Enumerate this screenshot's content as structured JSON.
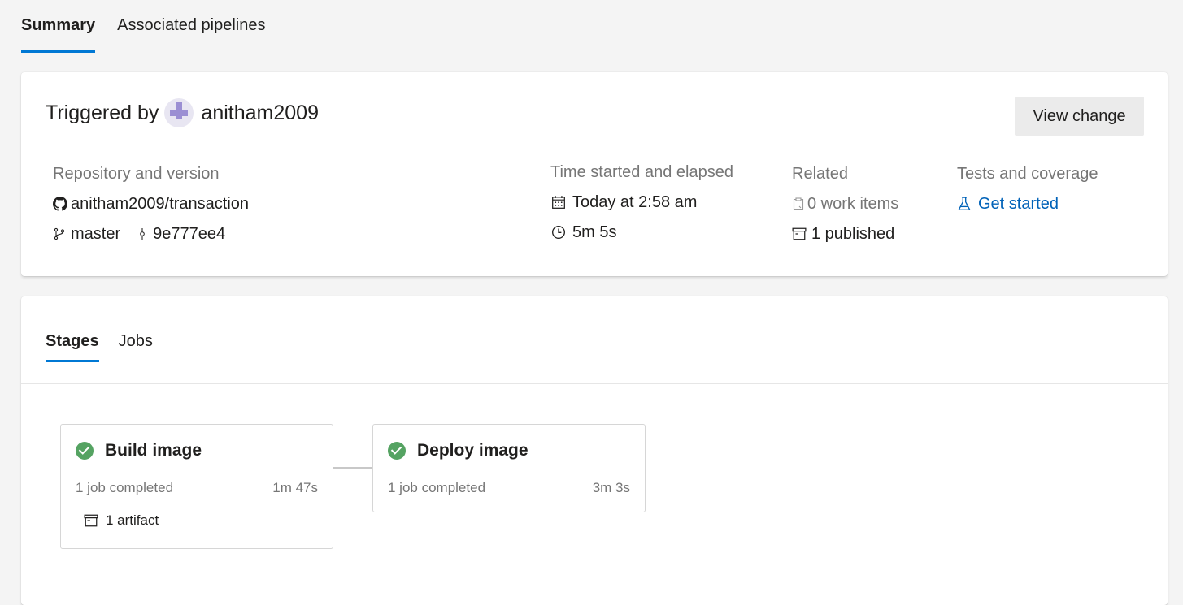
{
  "tabs": [
    {
      "label": "Summary",
      "active": true
    },
    {
      "label": "Associated pipelines",
      "active": false
    }
  ],
  "summary": {
    "triggered_prefix": "Triggered by",
    "user": "anitham2009",
    "view_change_label": "View change",
    "repository": {
      "label": "Repository and version",
      "repo": "anitham2009/transaction",
      "branch": "master",
      "commit": "9e777ee4"
    },
    "time": {
      "label": "Time started and elapsed",
      "started": "Today at 2:58 am",
      "elapsed": "5m 5s"
    },
    "related": {
      "label": "Related",
      "work_items": "0 work items",
      "published": "1 published"
    },
    "tests": {
      "label": "Tests and coverage",
      "link": "Get started"
    }
  },
  "stage_tabs": [
    {
      "label": "Stages",
      "active": true
    },
    {
      "label": "Jobs",
      "active": false
    }
  ],
  "stages": [
    {
      "name": "Build image",
      "jobs": "1 job completed",
      "duration": "1m 47s",
      "artifact": "1 artifact",
      "status": "succeeded"
    },
    {
      "name": "Deploy image",
      "jobs": "1 job completed",
      "duration": "3m 3s",
      "status": "succeeded"
    }
  ],
  "colors": {
    "accent": "#0078d4",
    "success": "#55a362",
    "link": "#0062b8"
  }
}
